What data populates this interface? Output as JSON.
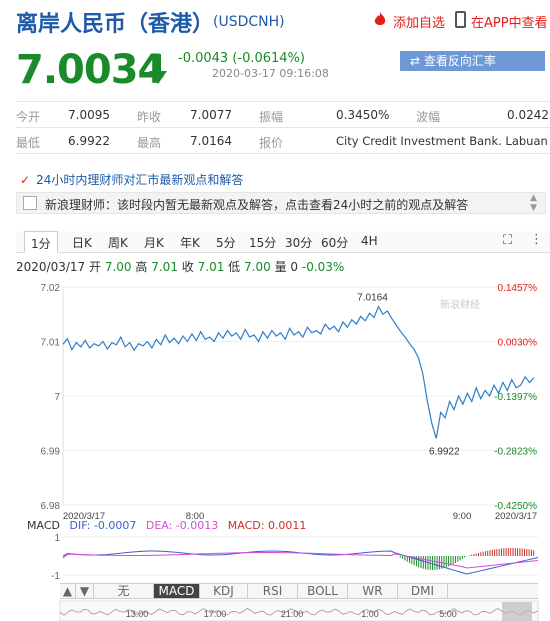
{
  "header": {
    "title": "离岸人民币（香港）",
    "code": "(USDCNH)",
    "add_watch": "添加自选",
    "app_watch": "在APP中查看"
  },
  "quote": {
    "price": "7.0034",
    "change": "-0.0043 (-0.0614%)",
    "time": "2020-03-17 09:16:08",
    "reverse_btn": "⇄ 查看反向汇率",
    "down_color": "#1a8a2a"
  },
  "stats": {
    "row1": [
      "今开",
      "7.0095",
      "昨收",
      "7.0077",
      "振幅",
      "0.3450%",
      "波幅",
      "0.0242"
    ],
    "row2": [
      "最低",
      "6.9922",
      "最高",
      "7.0164",
      "报价",
      "City Credit Investment Bank. Labuan"
    ]
  },
  "news": {
    "heading": "24小时内理财师对汇市最新观点和解答",
    "text": "新浪理财师：该时段内暂无最新观点及解答，点击查看24小时之前的观点及解答"
  },
  "tabs": [
    "1分",
    "日K",
    "周K",
    "月K",
    "年K",
    "5分",
    "15分",
    "30分",
    "60分",
    "4H"
  ],
  "ohlc": {
    "date": "2020/03/17",
    "open_label": "开",
    "open": "7.00",
    "high_label": "高",
    "high": "7.01",
    "close_label": "收",
    "close": "7.01",
    "low_label": "低",
    "low": "7.00",
    "vol_label": "量",
    "vol": "0",
    "pct": "-0.03%"
  },
  "chart_data": {
    "type": "line",
    "y_ticks": [
      "7.02",
      "7.01",
      "7",
      "6.99",
      "6.98"
    ],
    "pct_ticks": [
      "0.1457%",
      "0.0030%",
      "-0.1397%",
      "-0.2823%",
      "-0.4250%"
    ],
    "x_ticks": [
      "2020/3/17",
      "8:00",
      "9:00",
      "2020/3/17"
    ],
    "ylim": [
      6.98,
      7.02
    ],
    "high_label": "7.0164",
    "low_label": "6.9922",
    "watermark": "新浪财经",
    "series": [
      {
        "values": [
          7.0095,
          7.0105,
          7.0085,
          7.0098,
          7.009,
          7.0102,
          7.0088,
          7.0096,
          7.0092,
          7.01,
          7.0086,
          7.0098,
          7.0094,
          7.0108,
          7.009,
          7.0098,
          7.0084,
          7.0096,
          7.0092,
          7.01,
          7.0088,
          7.0104,
          7.0094,
          7.0112,
          7.0098,
          7.0106,
          7.0096,
          7.011,
          7.01,
          7.0114,
          7.0102,
          7.0118,
          7.0104,
          7.0108,
          7.01,
          7.0116,
          7.0106,
          7.012,
          7.011,
          7.0116,
          7.0104,
          7.0122,
          7.0108,
          7.0112,
          7.01,
          7.0118,
          7.0106,
          7.012,
          7.011,
          7.0116,
          7.0104,
          7.0124,
          7.0112,
          7.0118,
          7.0108,
          7.0126,
          7.0116,
          7.012,
          7.0114,
          7.0132,
          7.0122,
          7.0128,
          7.0118,
          7.0136,
          7.0126,
          7.014,
          7.0132,
          7.0146,
          7.0138,
          7.0152,
          7.0144,
          7.0164,
          7.015,
          7.0156,
          7.0142,
          7.013,
          7.0118,
          7.0108,
          7.0096,
          7.0086,
          7.007,
          7.004,
          6.999,
          6.995,
          6.9922,
          6.997,
          6.996,
          6.999,
          6.9975,
          7.0,
          6.9985,
          7.0005,
          6.999,
          7.0015,
          6.9995,
          7.001,
          7.0,
          7.002,
          7.0005,
          7.0025,
          7.001,
          7.003,
          7.0015,
          7.002,
          7.0035,
          7.0025,
          7.0034
        ]
      }
    ]
  },
  "macd": {
    "label": "MACD",
    "dif": "DIF: -0.0007",
    "dea": "DEA: -0.0013",
    "macd": "MACD: 0.0011",
    "y_ticks": [
      "1",
      "-1"
    ]
  },
  "indicators": [
    "▲",
    "▼",
    "无",
    "MACD",
    "KDJ",
    "RSI",
    "BOLL",
    "WR",
    "DMI"
  ],
  "timeline": [
    "13:00",
    "17:00",
    "21:00",
    "1:00",
    "5:00"
  ]
}
